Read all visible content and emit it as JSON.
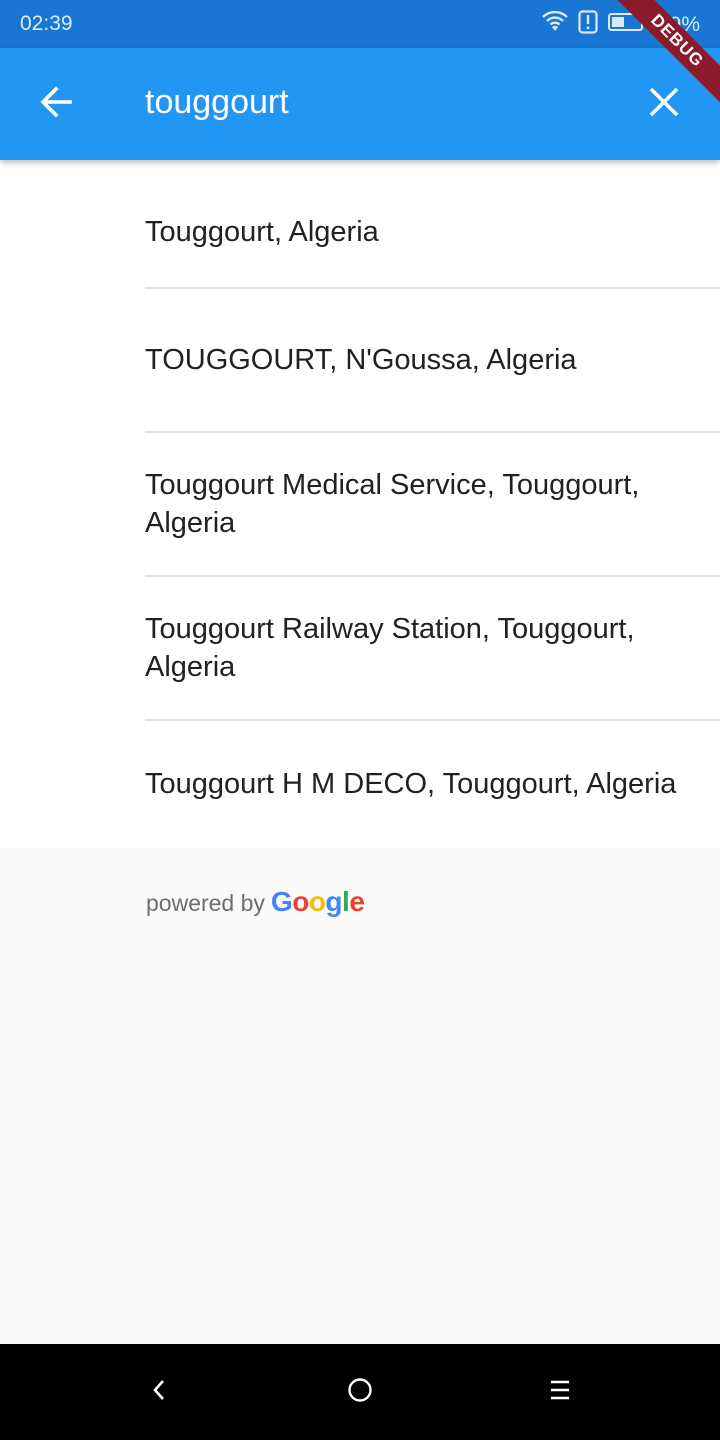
{
  "status_bar": {
    "time": "02:39",
    "battery_percent": "39%",
    "icons": [
      "wifi-icon",
      "alert-icon",
      "battery-icon"
    ]
  },
  "debug_banner": "DEBUG",
  "app_bar": {
    "back_icon": "arrow-back-icon",
    "search_value": "touggourt",
    "clear_icon": "close-icon",
    "color": "#2196f3"
  },
  "results": [
    {
      "label": "Touggourt, Algeria"
    },
    {
      "label": "TOUGGOURT, N'Goussa, Algeria"
    },
    {
      "label": "Touggourt Medical Service, Touggourt, Algeria"
    },
    {
      "label": "Touggourt Railway Station, Touggourt, Algeria"
    },
    {
      "label": "Touggourt H M DECO, Touggourt, Algeria"
    }
  ],
  "attribution": {
    "powered_by": "powered by",
    "google_letters": [
      "G",
      "o",
      "o",
      "g",
      "l",
      "e"
    ],
    "google_colors": [
      "#4285f4",
      "#ea4335",
      "#fbbc05",
      "#4285f4",
      "#34a853",
      "#ea4335"
    ]
  },
  "nav_bar": {
    "icons": [
      "nav-back-icon",
      "nav-home-icon",
      "nav-recents-icon"
    ]
  }
}
